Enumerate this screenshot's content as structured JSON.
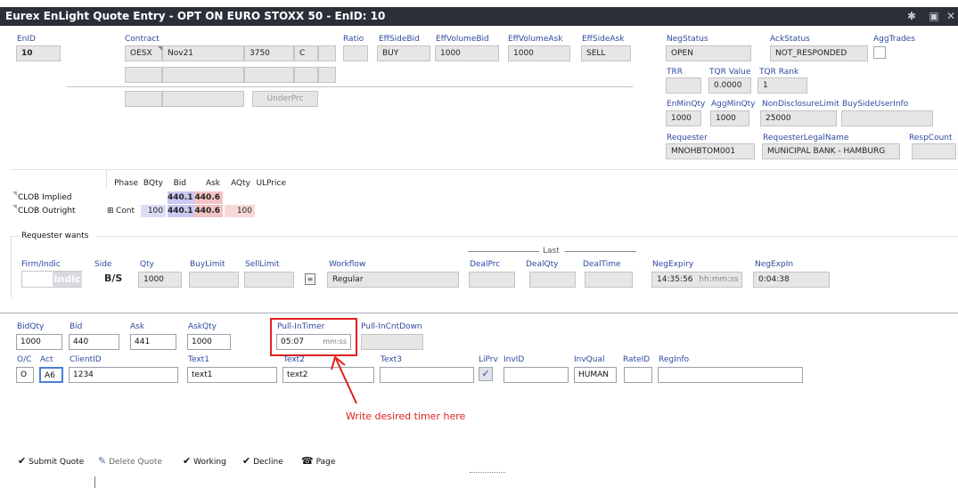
{
  "window": {
    "title": "Eurex EnLight Quote Entry - OPT ON EURO STOXX 50 - EnID: 10"
  },
  "header": {
    "enid_label": "EnID",
    "enid_value": "10",
    "contract_label": "Contract",
    "contract": {
      "product": "OESX",
      "expiry": "Nov21",
      "strike": "3750",
      "cp": "C"
    },
    "ratio_label": "Ratio",
    "eff_side_bid_label": "EffSideBid",
    "eff_side_bid": "BUY",
    "eff_volume_bid_label": "EffVolumeBid",
    "eff_volume_bid": "1000",
    "eff_volume_ask_label": "EffVolumeAsk",
    "eff_volume_ask": "1000",
    "eff_side_ask_label": "EffSideAsk",
    "eff_side_ask": "SELL",
    "underprc_label": "UnderPrc"
  },
  "right_panel": {
    "neg_status_label": "NegStatus",
    "neg_status": "OPEN",
    "ack_status_label": "AckStatus",
    "ack_status": "NOT_RESPONDED",
    "agg_trades_label": "AggTrades",
    "trr_label": "TRR",
    "tqr_value_label": "TQR Value",
    "tqr_value": "0.0000",
    "tqr_rank_label": "TQR Rank",
    "tqr_rank": "1",
    "en_min_qty_label": "EnMinQty",
    "en_min_qty": "1000",
    "agg_min_qty_label": "AggMinQty",
    "agg_min_qty": "1000",
    "non_disclosure_label": "NonDisclosureLimit",
    "non_disclosure": "25000",
    "buy_side_user_label": "BuySideUserInfo",
    "requester_label": "Requester",
    "requester": "MNOHBTOM001",
    "requester_legal_label": "RequesterLegalName",
    "requester_legal": "MUNICIPAL BANK - HAMBURG",
    "resp_count_label": "RespCount"
  },
  "market_grid": {
    "headers": [
      "Phase",
      "BQty",
      "Bid",
      "Ask",
      "AQty",
      "ULPrice"
    ],
    "rows": [
      {
        "name": "CLOB Implied",
        "phase": "",
        "bqty": "",
        "bid": "440.1",
        "ask": "440.6",
        "aqty": ""
      },
      {
        "name": "CLOB Outright",
        "expand": "⊞",
        "phase": "Cont",
        "bqty": "100",
        "bid": "440.1",
        "ask": "440.6",
        "aqty": "100"
      }
    ],
    "colors": {
      "bid_bg": "#c9c9f2",
      "ask_bg": "#f2c3c3",
      "bqty_bg": "#dcdcf7",
      "aqty_bg": "#f7d9d9"
    }
  },
  "requester_wants": {
    "section_label": "Requester wants",
    "firm_indic_label": "Firm/Indic",
    "firm_indic_value": "Indic",
    "side_label": "Side",
    "side_value": "B/S",
    "qty_label": "Qty",
    "qty": "1000",
    "buy_limit_label": "BuyLimit",
    "sell_limit_label": "SellLimit",
    "workflow_label": "Workflow",
    "workflow": "Regular",
    "last_label": "Last",
    "deal_prc_label": "DealPrc",
    "deal_qty_label": "DealQty",
    "deal_time_label": "DealTime",
    "neg_expiry_label": "NegExpiry",
    "neg_expiry": "14:35:56",
    "neg_expiry_hint": "hh:mm:ss",
    "neg_exp_in_label": "NegExpIn",
    "neg_exp_in": "0:04:38"
  },
  "quote": {
    "bid_qty_label": "BidQty",
    "bid_qty": "1000",
    "bid_label": "Bid",
    "bid": "440",
    "ask_label": "Ask",
    "ask": "441",
    "ask_qty_label": "AskQty",
    "ask_qty": "1000",
    "pull_in_timer_label": "Pull-InTimer",
    "pull_in_timer": "05:07",
    "pull_in_timer_hint": "mm:ss",
    "pull_in_countdown_label": "Pull-InCntDown",
    "oc_label": "O/C",
    "oc": "O",
    "act_label": "Act",
    "act": "A6",
    "client_id_label": "ClientID",
    "client_id": "1234",
    "text1_label": "Text1",
    "text1": "text1",
    "text2_label": "Text2",
    "text2": "text2",
    "text3_label": "Text3",
    "liprv_label": "LiPrv",
    "inv_id_label": "InvID",
    "inv_qual_label": "InvQual",
    "inv_qual": "HUMAN",
    "rate_id_label": "RateID",
    "reg_info_label": "RegInfo"
  },
  "annotation": {
    "text": "Write desired timer here",
    "color": "#e02020"
  },
  "toolbar": {
    "submit": "Submit Quote",
    "delete": "Delete Quote",
    "working": "Working",
    "decline": "Decline",
    "page": "Page"
  }
}
